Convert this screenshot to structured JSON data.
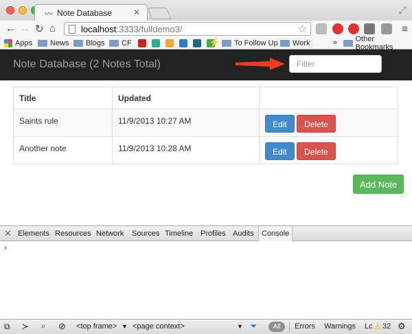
{
  "browser": {
    "tab_title": "Note Database",
    "url_host": "localhost",
    "url_rest": ":3333/fulldemo3/",
    "bookmarks": [
      "Apps",
      "News",
      "Blogs",
      "CF",
      "To Follow Up",
      "Work",
      "Other Bookmarks"
    ],
    "bookmark_overflow": "»"
  },
  "app": {
    "title": "Note Database (2 Notes Total)",
    "filter_placeholder": "Filter",
    "columns": [
      "Title",
      "Updated",
      ""
    ],
    "notes": [
      {
        "title": "Saints rule",
        "updated": "11/9/2013 10:27 AM"
      },
      {
        "title": "Another note",
        "updated": "11/9/2013 10:28 AM"
      }
    ],
    "edit_label": "Edit",
    "delete_label": "Delete",
    "add_label": "Add Note",
    "arrow_color": "#ee3a1e"
  },
  "devtools": {
    "tabs": [
      "Elements",
      "Resources",
      "Network",
      "Sources",
      "Timeline",
      "Profiles",
      "Audits",
      "Console"
    ],
    "active_tab": "Console",
    "prompt": "›",
    "frame_select": "<top frame>",
    "context_select": "<page context>",
    "filter_all": "All",
    "filters": [
      "Errors",
      "Warnings",
      "Lc"
    ],
    "warning_count": "32"
  },
  "colors": {
    "navbar": "#222222",
    "edit": "#428bca",
    "delete": "#d9534f",
    "add": "#5cb85c"
  }
}
